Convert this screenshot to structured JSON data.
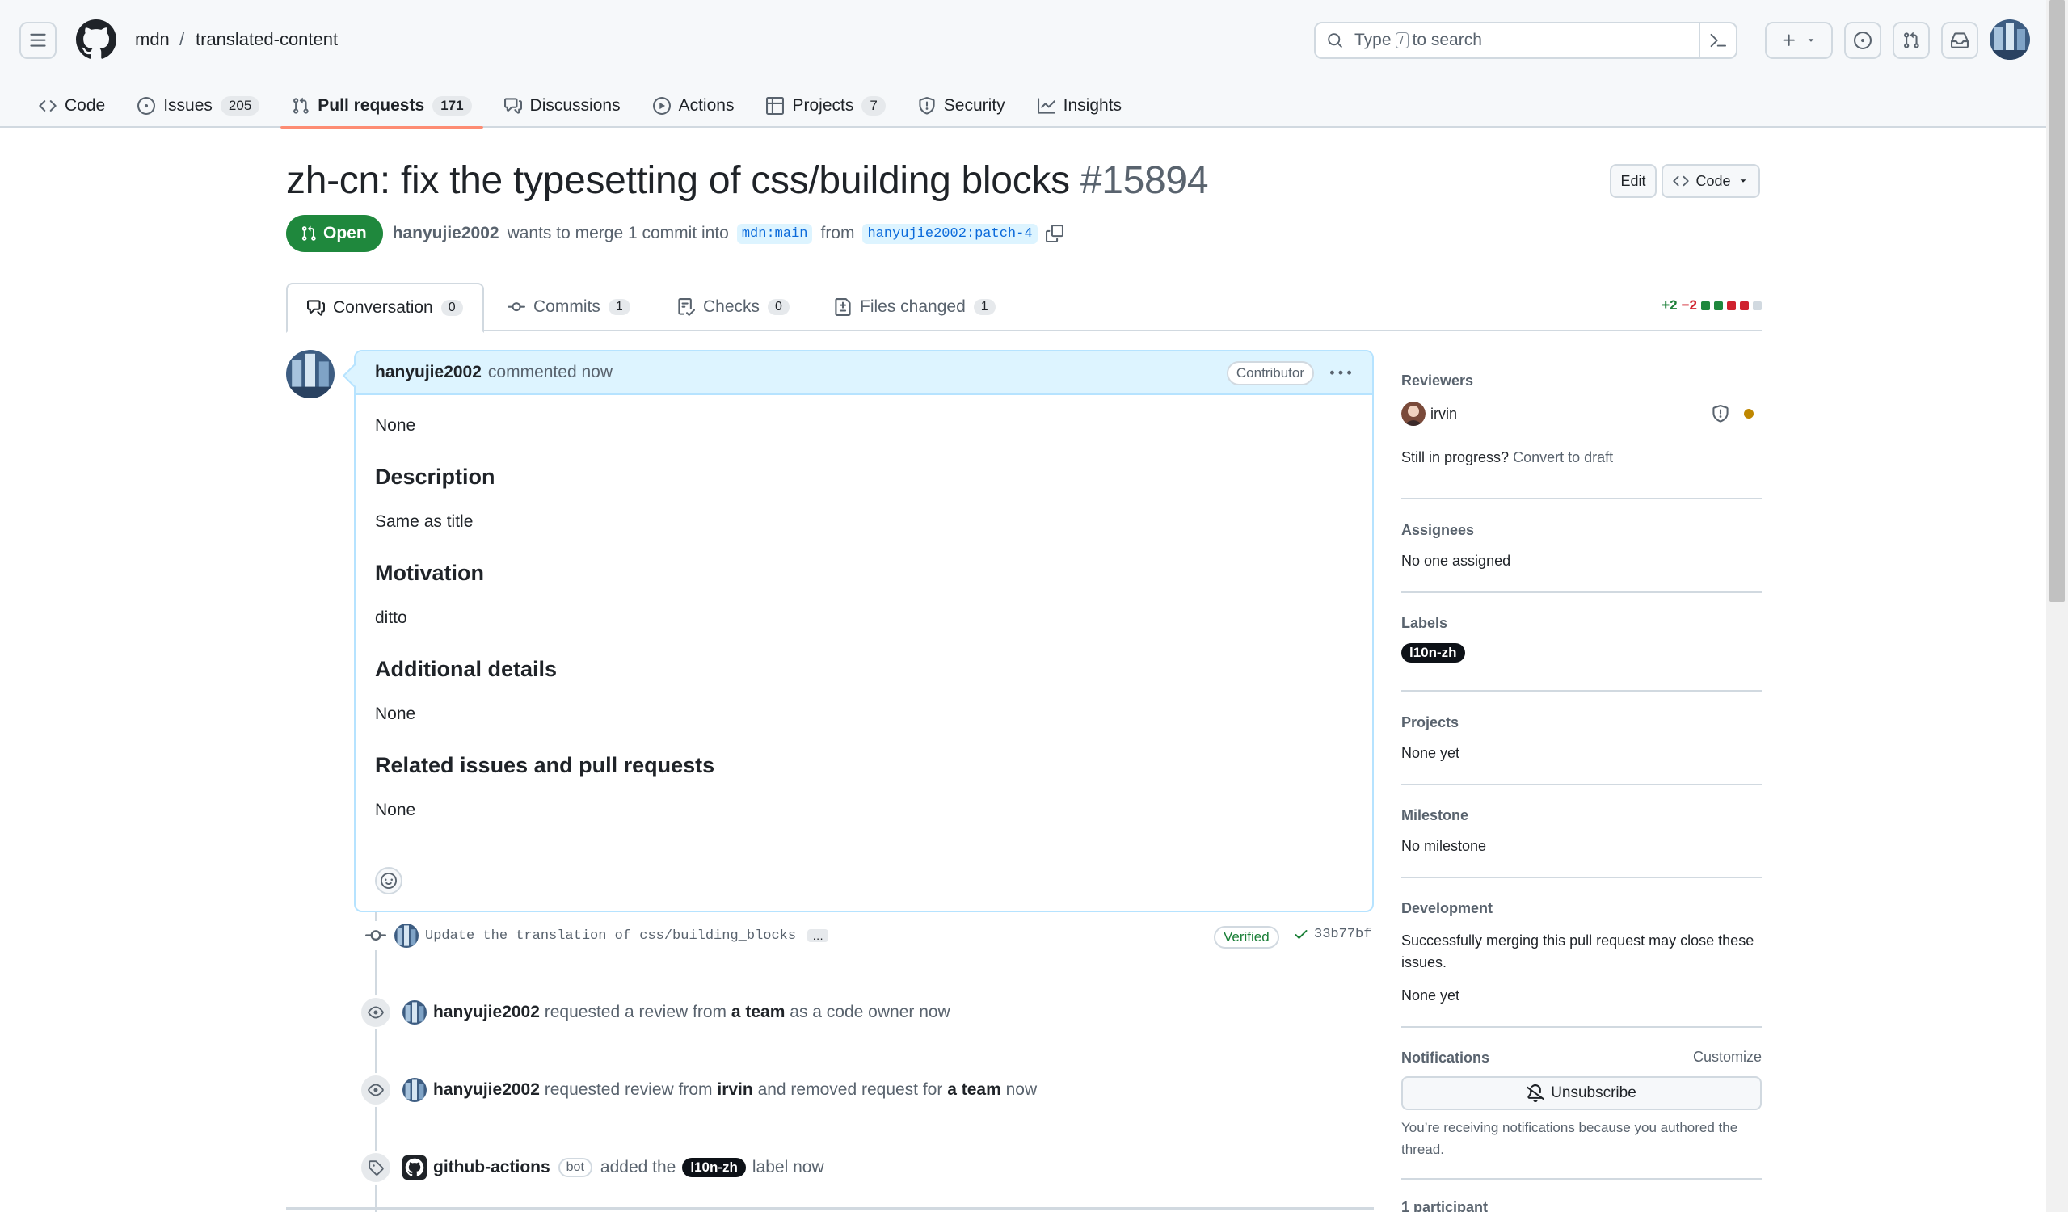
{
  "header": {
    "owner": "mdn",
    "separator": "/",
    "repo": "translated-content",
    "search_prefix": "Type",
    "search_key": "/",
    "search_suffix": "to search"
  },
  "repo_nav": [
    {
      "label": "Code",
      "icon": "code-icon"
    },
    {
      "label": "Issues",
      "count": "205",
      "icon": "issue-opened-icon"
    },
    {
      "label": "Pull requests",
      "count": "171",
      "icon": "git-pull-request-icon",
      "active": true
    },
    {
      "label": "Discussions",
      "icon": "comment-discussion-icon"
    },
    {
      "label": "Actions",
      "icon": "play-icon"
    },
    {
      "label": "Projects",
      "count": "7",
      "icon": "table-icon"
    },
    {
      "label": "Security",
      "icon": "shield-icon"
    },
    {
      "label": "Insights",
      "icon": "graph-icon"
    }
  ],
  "pr": {
    "title": "zh-cn: fix the typesetting of css/building blocks",
    "number": "#15894",
    "edit_label": "Edit",
    "code_label": "Code",
    "state": "Open",
    "author": "hanyujie2002",
    "merge_text": "wants to merge 1 commit into",
    "base_branch": "mdn:main",
    "from_text": "from",
    "head_branch": "hanyujie2002:patch-4"
  },
  "tabs": [
    {
      "label": "Conversation",
      "count": "0"
    },
    {
      "label": "Commits",
      "count": "1"
    },
    {
      "label": "Checks",
      "count": "0"
    },
    {
      "label": "Files changed",
      "count": "1"
    }
  ],
  "diffstat": {
    "additions": "+2",
    "deletions": "−2"
  },
  "comment": {
    "author": "hanyujie2002",
    "action": "commented now",
    "role": "Contributor",
    "intro": "None",
    "sections": [
      {
        "heading": "Description",
        "text": "Same as title"
      },
      {
        "heading": "Motivation",
        "text": "ditto"
      },
      {
        "heading": "Additional details",
        "text": "None"
      },
      {
        "heading": "Related issues and pull requests",
        "text": "None"
      }
    ]
  },
  "timeline": {
    "commit_message": "Update the translation of css/building_blocks",
    "commit_more": "…",
    "verified": "Verified",
    "sha": "33b77bf",
    "event1": {
      "actor": "hanyujie2002",
      "text1": "requested a review from",
      "target": "a team",
      "text2": "as a code owner now"
    },
    "event2": {
      "actor": "hanyujie2002",
      "text1": "requested review from",
      "target": "irvin",
      "text2": "and removed request for",
      "target2": "a team",
      "text3": "now"
    },
    "event3": {
      "actor": "github-actions",
      "bot": "bot",
      "text1": "added the",
      "label": "l10n-zh",
      "text2": "label now"
    }
  },
  "sidebar": {
    "reviewers_heading": "Reviewers",
    "reviewer": "irvin",
    "progress_text": "Still in progress?",
    "convert_draft": "Convert to draft",
    "assignees_heading": "Assignees",
    "assignees_value": "No one assigned",
    "labels_heading": "Labels",
    "label": "l10n-zh",
    "projects_heading": "Projects",
    "projects_value": "None yet",
    "milestone_heading": "Milestone",
    "milestone_value": "No milestone",
    "development_heading": "Development",
    "development_text": "Successfully merging this pull request may close these issues.",
    "development_value": "None yet",
    "notifications_heading": "Notifications",
    "customize": "Customize",
    "unsubscribe": "Unsubscribe",
    "notif_reason": "You’re receiving notifications because you authored the thread.",
    "participants": "1 participant"
  },
  "colors": {
    "open": "#1f883d",
    "accent": "#0969da",
    "tab_underline": "#fd8c73",
    "add": "#1a7f37",
    "del": "#d1242f"
  }
}
